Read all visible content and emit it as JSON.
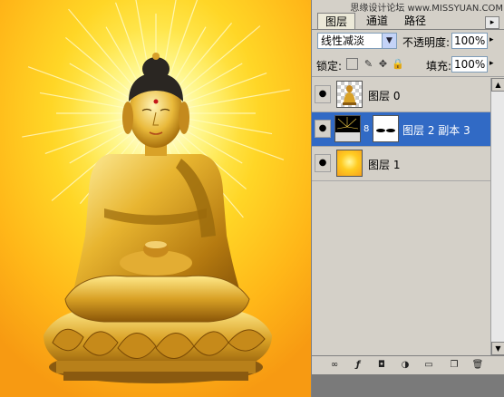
{
  "watermark": "思缘设计论坛 www.MISSYUAN.COM",
  "tabs": [
    {
      "label": "图层"
    },
    {
      "label": "通道"
    },
    {
      "label": "路径"
    }
  ],
  "blend_mode": "线性减淡",
  "opacity": {
    "label": "不透明度:",
    "value": "100%"
  },
  "lock_label": "锁定:",
  "fill": {
    "label": "填充:",
    "value": "100%"
  },
  "layers": [
    {
      "name": "图层 0",
      "visible": true,
      "selected": false
    },
    {
      "name": "图层 2 副本 3",
      "visible": true,
      "selected": true
    },
    {
      "name": "图层 1",
      "visible": true,
      "selected": false
    }
  ],
  "icons": {
    "eye": "eye-icon",
    "link": "link-layers-icon",
    "fx": "layer-style-icon",
    "mask": "add-mask-icon",
    "adjust": "adjustment-layer-icon",
    "group": "new-group-icon",
    "new": "new-layer-icon",
    "trash": "delete-layer-icon"
  },
  "colors": {
    "selection": "#316ac5",
    "panel": "#d4d0c8",
    "background_orange": "#f7a21b",
    "background_yellow": "#fff64a"
  }
}
